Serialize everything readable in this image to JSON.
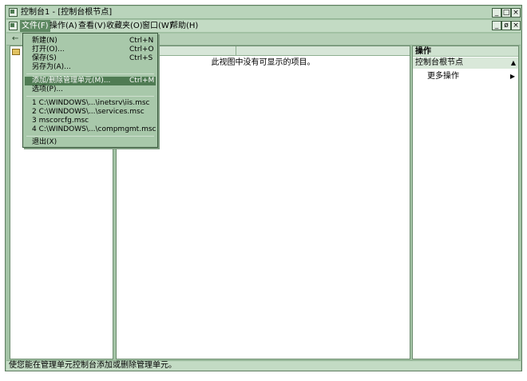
{
  "window": {
    "title": "控制台1 - [控制台根节点]",
    "title_buttons": [
      "_",
      "□",
      "×"
    ],
    "inner_buttons": [
      "_",
      "ø",
      "×"
    ]
  },
  "menubar": {
    "items": [
      {
        "label": "文件(F)",
        "active": true
      },
      {
        "label": "操作(A)"
      },
      {
        "label": "查看(V)"
      },
      {
        "label": "收藏夹(O)"
      },
      {
        "label": "窗口(W)"
      },
      {
        "label": "帮助(H)"
      }
    ]
  },
  "toolbar": {
    "back_glyph": "←"
  },
  "file_menu": {
    "items": [
      {
        "label": "新建(N)",
        "shortcut": "Ctrl+N"
      },
      {
        "label": "打开(O)...",
        "shortcut": "Ctrl+O"
      },
      {
        "label": "保存(S)",
        "shortcut": "Ctrl+S"
      },
      {
        "label": "另存为(A)...",
        "shortcut": ""
      },
      {
        "label": "添加/删除管理单元(M)...",
        "shortcut": "Ctrl+M",
        "selected": true
      },
      {
        "label": "选项(P)...",
        "shortcut": ""
      },
      {
        "label": "1 C:\\WINDOWS\\...\\inetsrv\\iis.msc",
        "shortcut": ""
      },
      {
        "label": "2 C:\\WINDOWS\\...\\services.msc",
        "shortcut": ""
      },
      {
        "label": "3 mscorcfg.msc",
        "shortcut": ""
      },
      {
        "label": "4 C:\\WINDOWS\\...\\compmgmt.msc",
        "shortcut": ""
      },
      {
        "label": "退出(X)",
        "shortcut": ""
      }
    ]
  },
  "list_view": {
    "empty_message": "此视图中没有可显示的项目。"
  },
  "actions_pane": {
    "header": "操作",
    "section_title": "控制台根节点",
    "section_arrow": "▲",
    "more_actions": "更多操作",
    "more_arrow": "▶"
  },
  "status": {
    "text": "使您能在管理单元控制台添加或删除管理单元。"
  }
}
